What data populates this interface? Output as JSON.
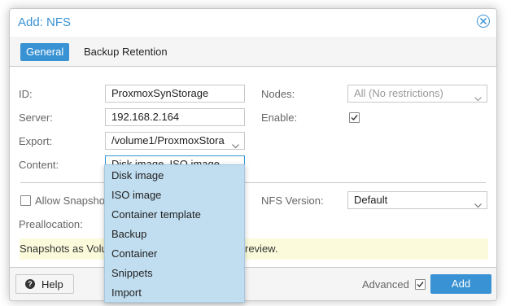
{
  "dialog": {
    "title": "Add: NFS",
    "tabs": [
      {
        "label": "General",
        "active": true
      },
      {
        "label": "Backup Retention",
        "active": false
      }
    ]
  },
  "form": {
    "id": {
      "label": "ID:",
      "value": "ProxmoxSynStorage"
    },
    "server": {
      "label": "Server:",
      "value": "192.168.2.164"
    },
    "export": {
      "label": "Export:",
      "value": "/volume1/ProxmoxStora"
    },
    "content": {
      "label": "Content:",
      "value": "Disk image, ISO image,"
    },
    "nodes": {
      "label": "Nodes:",
      "value": "All (No restrictions)"
    },
    "enable": {
      "label": "Enable:",
      "checked": true
    },
    "allow_snapshots": {
      "label": "Allow Snapsho",
      "checked": false
    },
    "nfs_version": {
      "label": "NFS Version:",
      "value": "Default"
    },
    "preallocation": {
      "label": "Preallocation:"
    }
  },
  "warning": {
    "text_left": "Snapshots as Volu",
    "text_right": "review."
  },
  "content_options": [
    "Disk image",
    "ISO image",
    "Container template",
    "Backup",
    "Container",
    "Snippets",
    "Import"
  ],
  "footer": {
    "help_label": "Help",
    "advanced_label": "Advanced",
    "advanced_checked": true,
    "add_label": "Add"
  },
  "colors": {
    "accent": "#3892d3",
    "dropdown_bg": "#c1def0",
    "warning_bg": "#fbfbdc"
  },
  "icons": {
    "close": "close-circle-icon",
    "help": "question-circle-icon",
    "chevron": "chevron-down-icon",
    "check": "checkmark-icon"
  }
}
